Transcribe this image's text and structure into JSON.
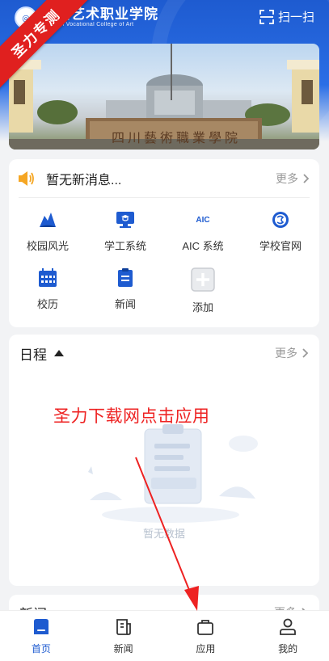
{
  "header": {
    "logo_cn": "四川艺术职业学院",
    "logo_en": "Sichuan Vocational College of Art",
    "scan_label": "扫一扫",
    "ribbon_label": "圣力专测"
  },
  "banner": {
    "gate_text": "四川藝術職業學院"
  },
  "notice": {
    "text": "暂无新消息...",
    "more_label": "更多"
  },
  "apps": [
    {
      "label": "校园风光",
      "icon": "campus-scenery-icon"
    },
    {
      "label": "学工系统",
      "icon": "student-affairs-icon"
    },
    {
      "label": "AIC 系统",
      "icon": "aic-icon"
    },
    {
      "label": "学校官网",
      "icon": "official-site-icon"
    },
    {
      "label": "校历",
      "icon": "calendar-icon"
    },
    {
      "label": "新闻",
      "icon": "news-icon"
    },
    {
      "label": "添加",
      "icon": "add-icon"
    }
  ],
  "schedule": {
    "title": "日程",
    "more_label": "更多",
    "empty_text": "暂无数据"
  },
  "overlay_annotation": "圣力下载网点击应用",
  "news_section": {
    "title": "新闻",
    "more_label": "更多"
  },
  "tabbar": {
    "tabs": [
      {
        "label": "首页",
        "active": true
      },
      {
        "label": "新闻",
        "active": false
      },
      {
        "label": "应用",
        "active": false
      },
      {
        "label": "我的",
        "active": false
      }
    ]
  },
  "colors": {
    "brand": "#1e5bd0",
    "ribbon": "#e0201f",
    "annotation": "#ee2222",
    "notice_icon": "#f5a623"
  }
}
